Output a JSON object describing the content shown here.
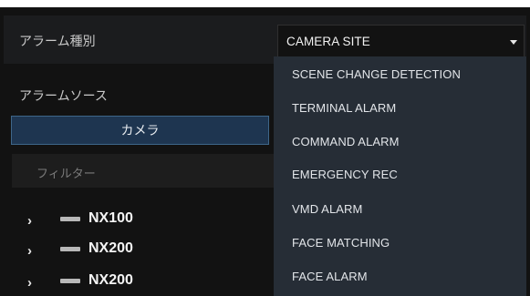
{
  "alarm_type": {
    "label": "アラーム種別",
    "selected": "CAMERA SITE"
  },
  "alarm_source": {
    "label": "アラームソース",
    "camera_button": "カメラ",
    "filter_placeholder": "フィルター"
  },
  "devices": [
    {
      "name": "NX100"
    },
    {
      "name": "NX200"
    },
    {
      "name": "NX200"
    }
  ],
  "dropdown_options": [
    "SCENE CHANGE DETECTION",
    "TERMINAL ALARM",
    "COMMAND ALARM",
    "EMERGENCY REC",
    "VMD ALARM",
    "FACE MATCHING",
    "FACE ALARM"
  ],
  "icons": {
    "caret": "caret-down-icon",
    "tree_expand": "chevron-right-icon",
    "device": "device-icon"
  }
}
